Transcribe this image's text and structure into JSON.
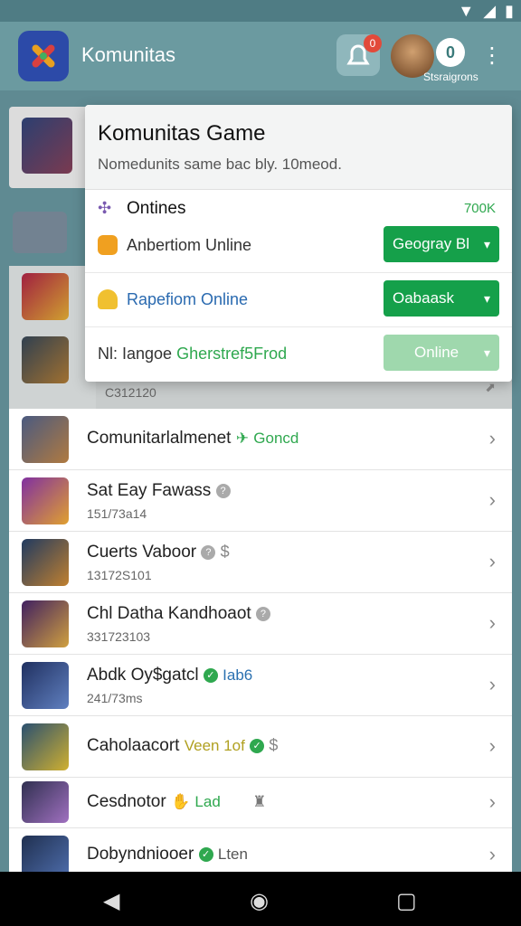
{
  "appbar": {
    "title": "Komunitas",
    "notification_count": "0",
    "status_initial": "0",
    "status_label": "Stsraigrons"
  },
  "background": {
    "partial_row_sub": "C312120"
  },
  "popup": {
    "title": "Komunitas Game",
    "subtitle": "Nomedunits same bac bly. 10meod.",
    "section_title": "Ontines",
    "section_count": "700K",
    "rows": [
      {
        "label": "Anbertiom Unline",
        "button": "Geogray Bl"
      },
      {
        "label": "Rapefiom Online",
        "button": "Oabaask"
      },
      {
        "label_prefix": "Nl: Iangoe",
        "label_accent": "Gherstref5Frod",
        "button": "Online"
      }
    ]
  },
  "list": [
    {
      "title": "Comunitarlalmenet",
      "tag": "Goncd"
    },
    {
      "title": "Sat Eay Fawass",
      "sub": "151/73a14"
    },
    {
      "title": "Cuerts Vaboor",
      "sub": "13172S101"
    },
    {
      "title": "Chl Datha Kandhoaot",
      "sub": "331723103"
    },
    {
      "title": "Abdk Oy$gatcl",
      "tag": "Iab6",
      "sub": "241/73ms"
    },
    {
      "title": "Caholaacort",
      "tag": "Veen 1of"
    },
    {
      "title": "Cesdnotor",
      "tag": "Lad"
    },
    {
      "title": "Dobyndniooer",
      "tag": "Lten"
    }
  ],
  "colors": {
    "accent": "#15a04a",
    "appbar": "#6b9aa0"
  }
}
